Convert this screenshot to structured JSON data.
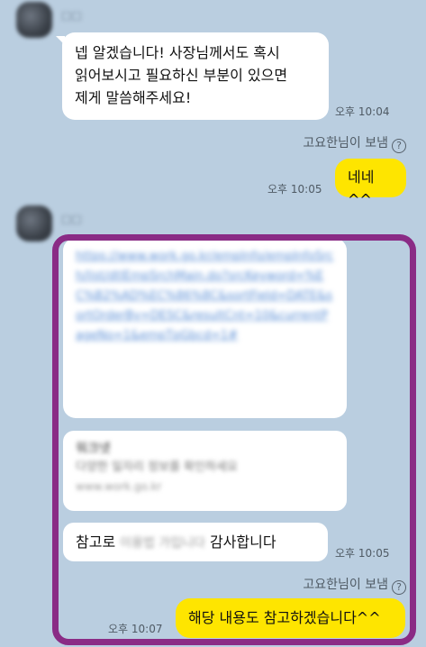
{
  "chat": {
    "msg1": {
      "sender_name": "□□",
      "text_lines": [
        "넵 알겠습니다! 사장님께서도 혹시",
        "읽어보시고 필요하신 부분이 있으면",
        "제게 말씀해주세요!"
      ],
      "time": "오후 10:04"
    },
    "sent_by_1": "고요한님이 보냄",
    "reply1": {
      "text": "네네^^",
      "time": "오후 10:05"
    },
    "msg2": {
      "sender_name": "□□",
      "link_text": "https://www.work.go.kr/empInfo/empInfoSrch/list/dtlEmpSrchMain.do?srcKeyword=%EC%B2%AD%EC%86%8C&sortField=DATE&sortOrderBy=DESC&resultCnt=10&currentPageNo=1&empTpGbcd=1#",
      "preview_title": "워크넷",
      "preview_desc": "다양한 일자리 정보를 확인하세요",
      "preview_url": "www.work.go.kr",
      "text_prefix": "참고로 ",
      "text_blurred": "이용법 가입니다",
      "text_suffix": " 감사합니다",
      "time": "오후 10:05"
    },
    "sent_by_2": "고요한님이 보냄",
    "reply2": {
      "text": "해당 내용도 참고하겠습니다^^",
      "time": "오후 10:07"
    }
  },
  "icons": {
    "info": "info-circle-icon"
  },
  "colors": {
    "background": "#bacee0",
    "my_bubble": "#fee500",
    "their_bubble": "#ffffff",
    "highlight": "#8a2b85"
  }
}
